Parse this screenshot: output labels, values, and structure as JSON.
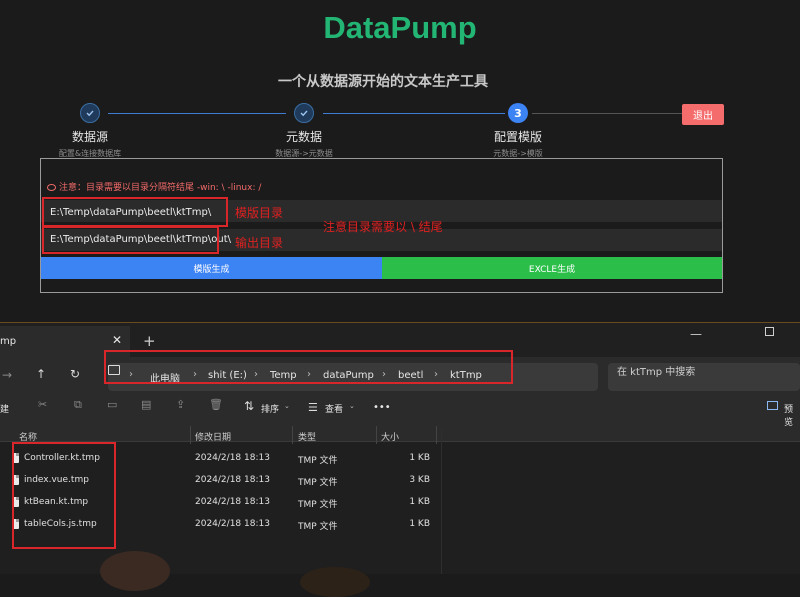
{
  "app": {
    "title": "DataPump",
    "subtitle": "一个从数据源开始的文本生产工具",
    "steps": [
      {
        "title": "数据源",
        "desc": "配置&连接数据库",
        "state": "done",
        "icon": "check-icon"
      },
      {
        "title": "元数据",
        "desc": "数据源->元数据",
        "state": "done",
        "icon": "check-icon"
      },
      {
        "title": "配置模版",
        "desc": "元数据->模版",
        "state": "active",
        "number": "3"
      }
    ],
    "logout_label": "退出",
    "warning": "注意：目录需要以目录分隔符结尾 -win: \\ -linux: /",
    "template_dir_value": "E:\\Temp\\dataPump\\beetl\\ktTmp\\",
    "output_dir_value": "E:\\Temp\\dataPump\\beetl\\ktTmp\\out\\",
    "annotations": {
      "template_dir": "模版目录",
      "output_dir": "输出目录",
      "note": "注意目录需要以 \\ 结尾"
    },
    "buttons": {
      "template_gen": "模版生成",
      "excel_gen": "EXCLE生成"
    },
    "colors": {
      "brand": "#22b573",
      "accent": "#3c83f3",
      "danger": "#f56c6c",
      "excel": "#2bbf4a",
      "annotation": "#e02020"
    }
  },
  "explorer": {
    "tab_label": "mp",
    "breadcrumb": [
      "此电脑",
      "shit (E:)",
      "Temp",
      "dataPump",
      "beetl",
      "ktTmp"
    ],
    "search_placeholder": "在 ktTmp 中搜索",
    "toolbar": {
      "sort": "排序",
      "view": "查看",
      "more": "•••",
      "preview": "预览",
      "new": "建"
    },
    "columns": {
      "name": "名称",
      "modified": "修改日期",
      "type": "类型",
      "size": "大小"
    },
    "files": [
      {
        "name": "Controller.kt.tmp",
        "modified": "2024/2/18 18:13",
        "type": "TMP 文件",
        "size": "1 KB"
      },
      {
        "name": "index.vue.tmp",
        "modified": "2024/2/18 18:13",
        "type": "TMP 文件",
        "size": "3 KB"
      },
      {
        "name": "ktBean.kt.tmp",
        "modified": "2024/2/18 18:13",
        "type": "TMP 文件",
        "size": "1 KB"
      },
      {
        "name": "tableCols.js.tmp",
        "modified": "2024/2/18 18:13",
        "type": "TMP 文件",
        "size": "1 KB"
      }
    ]
  }
}
